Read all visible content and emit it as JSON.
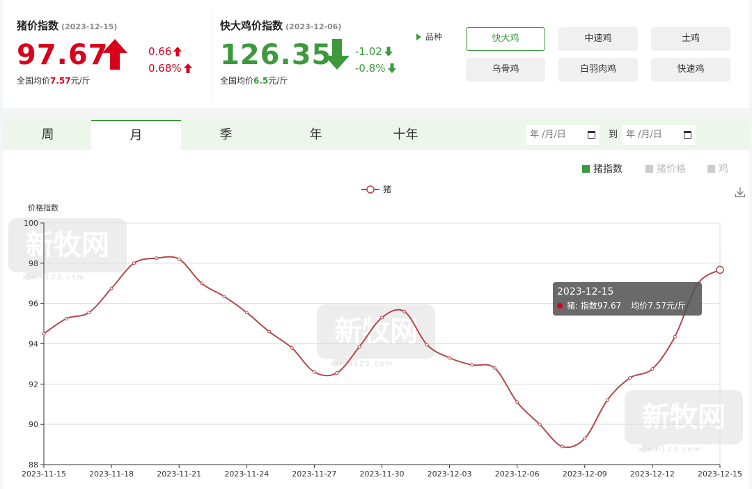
{
  "pig_index": {
    "title": "猪价指数",
    "date": "(2023-12-15)",
    "value": "97.67",
    "change_abs": "0.66",
    "change_pct": "0.68%",
    "avg_prefix": "全国均价",
    "avg_value": "7.57",
    "avg_suffix": "元/斤"
  },
  "chicken_index": {
    "title": "快大鸡价指数",
    "date": "(2023-12-06)",
    "value": "126.35",
    "change_abs": "-1.02",
    "change_pct": "-0.8%",
    "avg_prefix": "全国均价",
    "avg_value": "6.5",
    "avg_suffix": "元/斤"
  },
  "variety": {
    "label": "品种",
    "options": [
      "快大鸡",
      "中速鸡",
      "土鸡",
      "乌骨鸡",
      "白羽肉鸡",
      "快速鸡"
    ],
    "selected": "快大鸡"
  },
  "tabs": [
    "周",
    "月",
    "季",
    "年",
    "十年"
  ],
  "active_tab": "月",
  "date_range": {
    "start_placeholder": "年 /月/日",
    "to_label": "到",
    "end_placeholder": "年 /月/日"
  },
  "modes": [
    "猪指数",
    "猪价格",
    "鸡"
  ],
  "active_mode": "猪指数",
  "watermark": {
    "text": "新牧网",
    "sub": "xinm123.com"
  },
  "tooltip": {
    "date": "2023-12-15",
    "series": "猪:",
    "index_text": "指数97.67",
    "avg_text": "均价7.57元/斤"
  },
  "colors": {
    "line": "#b5474b",
    "accent_green": "#3c9a3c",
    "accent_red": "#d9001b"
  },
  "chart_data": {
    "type": "line",
    "legend": "猪",
    "ylabel": "价格指数",
    "ylim": [
      88,
      100
    ],
    "yticks": [
      88,
      90,
      92,
      94,
      96,
      98,
      100
    ],
    "xtick_labels": [
      "2023-11-15",
      "2023-11-18",
      "2023-11-21",
      "2023-11-24",
      "2023-11-27",
      "2023-11-30",
      "2023-12-03",
      "2023-12-06",
      "2023-12-09",
      "2023-12-12",
      "2023-12-15"
    ],
    "x": [
      "2023-11-15",
      "2023-11-16",
      "2023-11-17",
      "2023-11-18",
      "2023-11-19",
      "2023-11-20",
      "2023-11-21",
      "2023-11-22",
      "2023-11-23",
      "2023-11-24",
      "2023-11-25",
      "2023-11-26",
      "2023-11-27",
      "2023-11-28",
      "2023-11-29",
      "2023-11-30",
      "2023-12-01",
      "2023-12-02",
      "2023-12-03",
      "2023-12-04",
      "2023-12-05",
      "2023-12-06",
      "2023-12-07",
      "2023-12-08",
      "2023-12-09",
      "2023-12-10",
      "2023-12-11",
      "2023-12-12",
      "2023-12-13",
      "2023-12-14",
      "2023-12-15"
    ],
    "series": [
      {
        "name": "猪",
        "values": [
          94.5,
          95.25,
          95.55,
          96.75,
          98.0,
          98.25,
          98.2,
          97.0,
          96.35,
          95.55,
          94.6,
          93.8,
          92.6,
          92.55,
          93.85,
          95.3,
          95.6,
          93.95,
          93.3,
          92.95,
          92.8,
          91.1,
          90.0,
          88.9,
          89.3,
          91.2,
          92.3,
          92.75,
          94.35,
          96.95,
          97.67
        ]
      }
    ]
  }
}
